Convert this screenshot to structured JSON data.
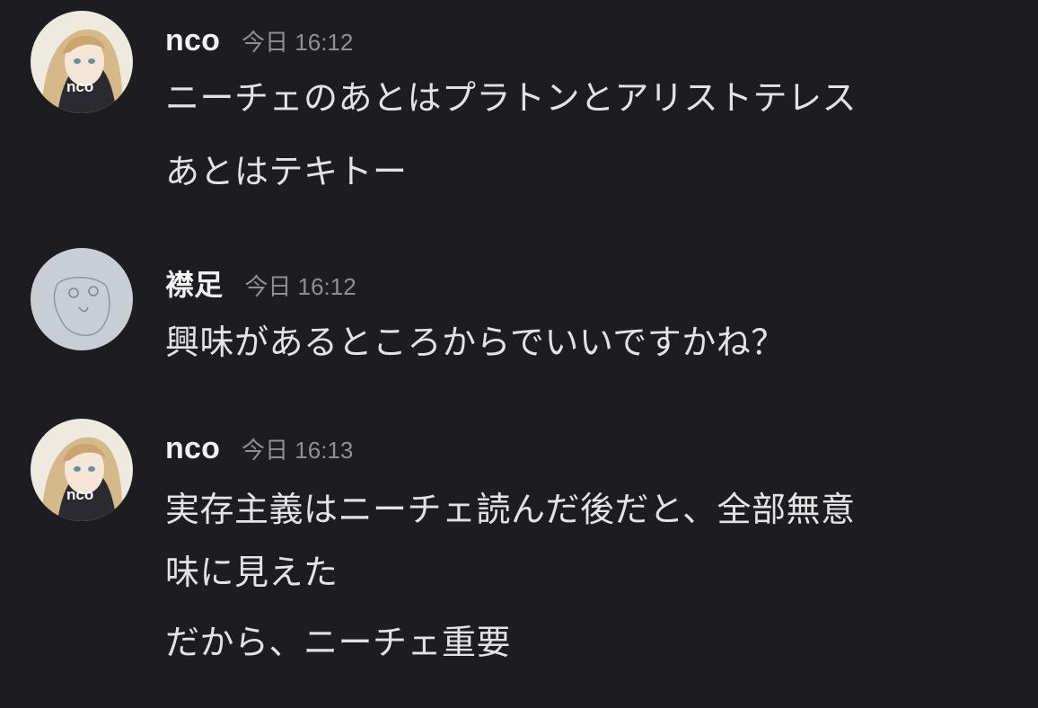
{
  "messages": [
    {
      "author": "nco",
      "timestamp": "今日 16:12",
      "avatar_text": "nco",
      "lines": [
        "ニーチェのあとはプラトンとアリストテレス",
        "あとはテキトー"
      ]
    },
    {
      "author": "襟足",
      "timestamp": "今日 16:12",
      "lines": [
        "興味があるところからでいいですかね？"
      ]
    },
    {
      "author": "nco",
      "timestamp": "今日 16:13",
      "avatar_text": "nco",
      "lines": [
        "実存主義はニーチェ読んだ後だと、全部無意",
        "味に見えた",
        "だから、ニーチェ重要"
      ]
    }
  ],
  "colors": {
    "background": "#1c1c21",
    "author": "#f2f2f4",
    "timestamp": "#8e8f97",
    "message_text": "#e3e3e6"
  }
}
